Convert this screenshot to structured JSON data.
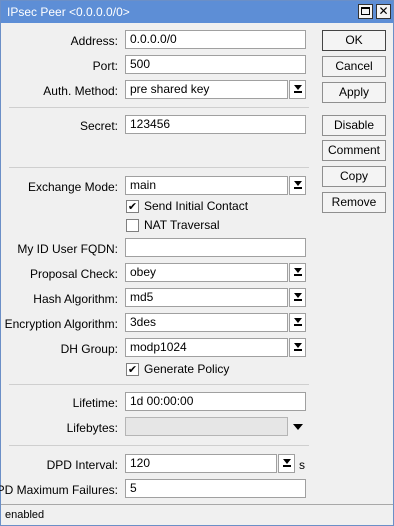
{
  "window": {
    "title": "IPsec Peer <0.0.0.0/0>",
    "minimize_icon": "restore-icon",
    "close_icon": "close-icon"
  },
  "form": {
    "address": {
      "label": "Address:",
      "value": "0.0.0.0/0"
    },
    "port": {
      "label": "Port:",
      "value": "500"
    },
    "auth_method": {
      "label": "Auth. Method:",
      "value": "pre shared key"
    },
    "secret": {
      "label": "Secret:",
      "value": "123456"
    },
    "exchange_mode": {
      "label": "Exchange Mode:",
      "value": "main"
    },
    "send_initial_contact": {
      "label": "Send Initial Contact",
      "checked": true
    },
    "nat_traversal": {
      "label": "NAT Traversal",
      "checked": false
    },
    "my_id_user_fqdn": {
      "label": "My ID User FQDN:",
      "value": ""
    },
    "proposal_check": {
      "label": "Proposal Check:",
      "value": "obey"
    },
    "hash_algorithm": {
      "label": "Hash Algorithm:",
      "value": "md5"
    },
    "encryption_algorithm": {
      "label": "Encryption Algorithm:",
      "value": "3des"
    },
    "dh_group": {
      "label": "DH Group:",
      "value": "modp1024"
    },
    "generate_policy": {
      "label": "Generate Policy",
      "checked": true
    },
    "lifetime": {
      "label": "Lifetime:",
      "value": "1d 00:00:00"
    },
    "lifebytes": {
      "label": "Lifebytes:",
      "value": ""
    },
    "dpd_interval": {
      "label": "DPD Interval:",
      "value": "120",
      "unit": "s"
    },
    "dpd_max_failures": {
      "label": "DPD Maximum Failures:",
      "value": "5"
    }
  },
  "buttons": {
    "ok": "OK",
    "cancel": "Cancel",
    "apply": "Apply",
    "disable": "Disable",
    "comment": "Comment",
    "copy": "Copy",
    "remove": "Remove"
  },
  "status": {
    "text": "enabled"
  },
  "colors": {
    "titlebar": "#5d8ed6",
    "window_bg": "#f0f0f0",
    "field_bg": "#ffffff",
    "disabled_field_bg": "#e6e6e6"
  },
  "checkmark": "✔"
}
